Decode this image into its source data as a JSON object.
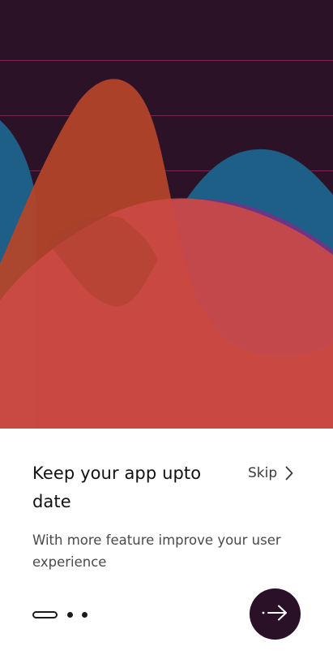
{
  "onboarding": {
    "title": "Keep your app upto date",
    "subtitle": "With more feature improve your user experience",
    "skip_label": "Skip",
    "current_page": 1,
    "total_pages": 3
  },
  "colors": {
    "hero_background": "#2c1226",
    "gridline": "#8a2a6e",
    "wave_orange": "#b3442a",
    "wave_blue": "#1d5f86",
    "wave_purple": "#6e3586",
    "wave_red": "#cc4a45",
    "button_background": "#2a1128",
    "text_primary": "#111111",
    "text_secondary": "#4a4a4a"
  },
  "icons": {
    "skip": "chevron-right-icon",
    "next": "arrow-right-icon"
  }
}
